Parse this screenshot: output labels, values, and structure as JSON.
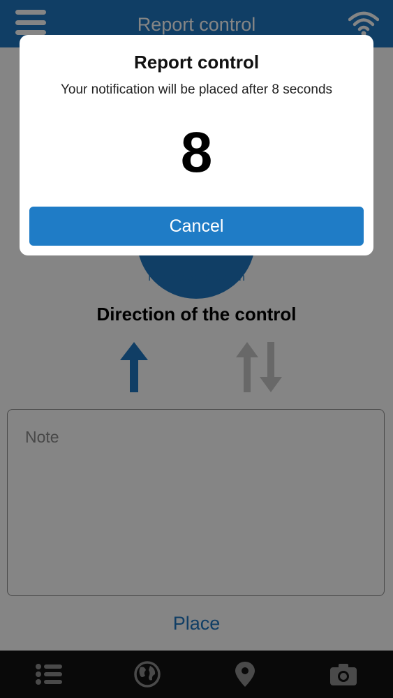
{
  "header": {
    "title": "Report control",
    "menu_icon": "hamburger-menu-icon",
    "signal_icon": "wifi-icon"
  },
  "main": {
    "direction_caption": "North east direction",
    "control_heading": "Direction of the control",
    "direction_options": [
      {
        "icon": "arrow-up-icon",
        "selected": true
      },
      {
        "icon": "arrows-up-down-icon",
        "selected": false
      }
    ],
    "note_placeholder": "Note",
    "place_label": "Place"
  },
  "tabbar": {
    "tabs": [
      {
        "icon": "list-icon"
      },
      {
        "icon": "globe-icon"
      },
      {
        "icon": "location-pin-icon"
      },
      {
        "icon": "camera-icon"
      }
    ]
  },
  "dialog": {
    "title": "Report control",
    "message": "Your notification will be placed after 8 seconds",
    "countdown": "8",
    "cancel_label": "Cancel"
  },
  "colors": {
    "accent": "#1f78c2",
    "tabbar": "#121212",
    "selected_arrow": "#1f78c2",
    "unselected_arrow": "#c8c8c8"
  }
}
